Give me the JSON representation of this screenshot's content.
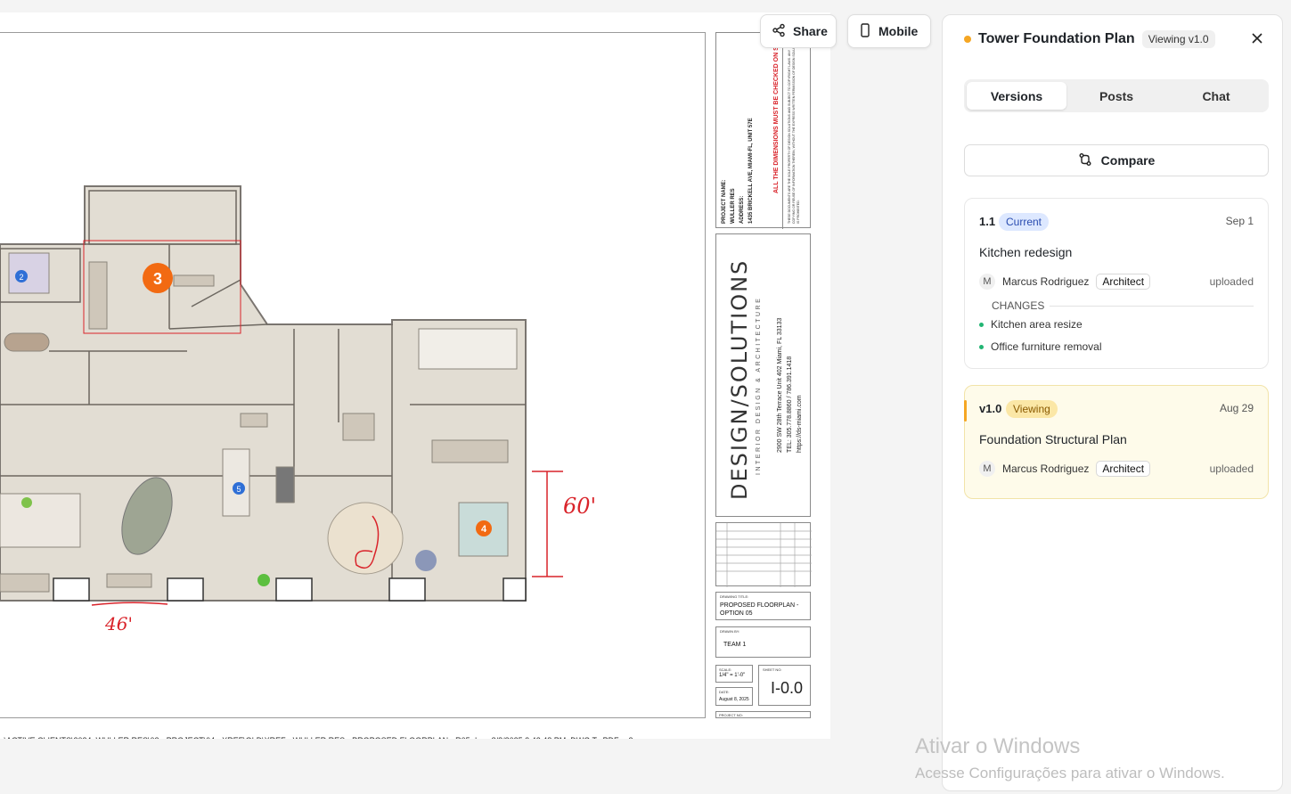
{
  "drawing": {
    "file_path": "s\\ACTIVE CLIENTS\\2024_WULLER RES\\02 - PROJECT\\04 - XREF\\OLD\\XREF - WULLER RES - PROPOSED FLOORPLAN - R05.dwg, 8/8/2025 2:42:48 PM, DWG To PDF.pc3",
    "markers": [
      "2",
      "3",
      "5",
      "4"
    ],
    "dimension_right": "60'",
    "dimension_bottom": "46'"
  },
  "title_block": {
    "project_name_label": "PROJECT NAME:",
    "project_name": "WULLER RES",
    "address_label": "ADDRESS:",
    "address": "1435 BRICKELL AVE, MIAMI-FL, UNIT 57E",
    "warning": "ALL THE DIMENSIONS MUST BE CHECKED ON S",
    "legal": "THESE DOCUMENTS ARE THE SOLE PROPERTY OF DESIGN SOLUTIONS AND SUBJECT TO COPYRIGHT LAWS. ANY COPYING OR REUSE OF INFORMATION THEREIN, WITHOUT THE EXPRESS WRITTEN PERMISSION OF DESIGN SOLUTIONS, IS PROHIBITED.",
    "firm_name": "DESIGN/SOLUTIONS",
    "firm_sub": "INTERIOR DESIGN & ARCHITECTURE",
    "firm_address": "2900 SW 28th Terrace Unit 402 Miami, FL 33133",
    "firm_tel": "TEL: 305.778.8860 / 786.391.1418",
    "firm_web": "https://ds-miami.com",
    "drawing_title_label": "DRAWING TITLE:",
    "drawing_title": "PROPOSED FLOORPLAN - OPTION 05",
    "drawn_by_label": "DRAWN BY:",
    "drawn_by": "TEAM 1",
    "scale_label": "SCALE:",
    "scale": "1/4\" = 1'-0\"",
    "sheet_no_label": "SHEET NO:",
    "sheet_no": "I-0.0",
    "date_label": "DATE:",
    "date": "August 8, 2025",
    "project_no_label": "PROJECT NO:"
  },
  "toolbar": {
    "share_label": "Share",
    "mobile_label": "Mobile"
  },
  "panel": {
    "title": "Tower Foundation Plan",
    "viewing_badge": "Viewing v1.0",
    "tabs": [
      {
        "label": "Versions",
        "active": true
      },
      {
        "label": "Posts",
        "active": false
      },
      {
        "label": "Chat",
        "active": false
      }
    ],
    "compare_label": "Compare",
    "versions": [
      {
        "version": "1.1",
        "badge": "Current",
        "date": "Sep 1",
        "title": "Kitchen redesign",
        "avatar": "M",
        "user": "Marcus Rodriguez",
        "role": "Architect",
        "action": "uploaded",
        "changes_label": "CHANGES",
        "changes": [
          "Kitchen area resize",
          "Office furniture removal"
        ]
      },
      {
        "version": "v1.0",
        "badge": "Viewing",
        "date": "Aug 29",
        "title": "Foundation Structural Plan",
        "avatar": "M",
        "user": "Marcus Rodriguez",
        "role": "Architect",
        "action": "uploaded"
      }
    ]
  },
  "watermark": {
    "line1": "Ativar o Windows",
    "line2": "Acesse Configurações para ativar o Windows."
  },
  "colors": {
    "accent_orange": "#f5a623",
    "marker_orange": "#f26a12",
    "marker_blue": "#2f6fd6",
    "current_badge_bg": "#dde8ff",
    "viewing_card_bg": "#fefbea",
    "change_dot": "#22b573",
    "redline": "#d9232a"
  },
  "icons": {
    "share": "share-icon",
    "mobile": "mobile-icon",
    "close": "close-icon",
    "compare": "compare-icon"
  }
}
